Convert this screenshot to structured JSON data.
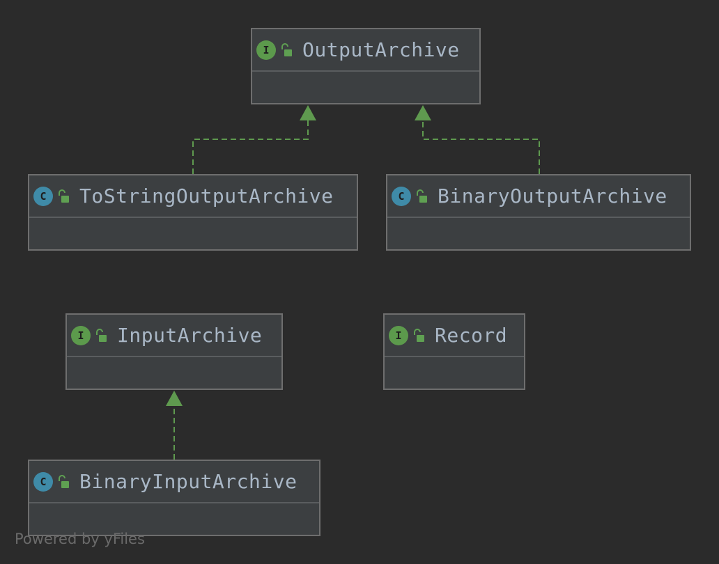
{
  "colors": {
    "interface_badge": "#5c9a4c",
    "class_badge": "#3f8ba8",
    "edge": "#5f9a4f",
    "lock": "#5fa052"
  },
  "nodes": [
    {
      "id": "OutputArchive",
      "kind": "I",
      "label": "OutputArchive",
      "icon": "interface-icon"
    },
    {
      "id": "ToStringOutputArchive",
      "kind": "C",
      "label": "ToStringOutputArchive",
      "icon": "class-icon"
    },
    {
      "id": "BinaryOutputArchive",
      "kind": "C",
      "label": "BinaryOutputArchive",
      "icon": "class-icon"
    },
    {
      "id": "InputArchive",
      "kind": "I",
      "label": "InputArchive",
      "icon": "interface-icon"
    },
    {
      "id": "Record",
      "kind": "I",
      "label": "Record",
      "icon": "interface-icon"
    },
    {
      "id": "BinaryInputArchive",
      "kind": "C",
      "label": "BinaryInputArchive",
      "icon": "class-icon"
    }
  ],
  "edges": [
    {
      "from": "ToStringOutputArchive",
      "to": "OutputArchive",
      "type": "implements"
    },
    {
      "from": "BinaryOutputArchive",
      "to": "OutputArchive",
      "type": "implements"
    },
    {
      "from": "BinaryInputArchive",
      "to": "InputArchive",
      "type": "implements"
    }
  ],
  "watermark": "Powered by yFiles"
}
